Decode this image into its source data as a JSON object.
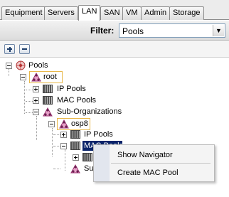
{
  "tabs": [
    {
      "label": "Equipment"
    },
    {
      "label": "Servers"
    },
    {
      "label": "LAN"
    },
    {
      "label": "SAN"
    },
    {
      "label": "VM"
    },
    {
      "label": "Admin"
    },
    {
      "label": "Storage"
    }
  ],
  "active_tab": "LAN",
  "filter": {
    "label": "Filter:",
    "value": "Pools",
    "dropdown_icon": "chevron-down-icon"
  },
  "toolbar": {
    "expand_icon": "plus-icon",
    "collapse_icon": "minus-icon"
  },
  "tree": {
    "root_label": "Pools",
    "root_org": "root",
    "ip_pools": "IP Pools",
    "mac_pools": "MAC Pools",
    "sub_orgs": "Sub-Organizations",
    "sub_org": "osp8",
    "sub_ip_pools": "IP Pools",
    "sub_mac_pools": "MAC Pools",
    "sub_sub_orgs_partial": "Sul"
  },
  "context_menu": {
    "items": [
      {
        "label": "Show Navigator"
      },
      {
        "label": "Create MAC Pool"
      }
    ]
  },
  "colors": {
    "selection": "#0a246a",
    "org_highlight_border": "#e8b84a"
  }
}
